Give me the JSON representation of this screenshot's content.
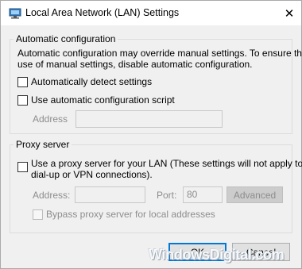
{
  "window": {
    "title": "Local Area Network (LAN) Settings",
    "close_glyph": "✕"
  },
  "automatic_configuration": {
    "legend": "Automatic configuration",
    "description_line1": "Automatic configuration may override manual settings.  To ensure the",
    "description_line2": "use of manual settings, disable automatic configuration.",
    "auto_detect_label": "Automatically detect settings",
    "auto_detect_checked": false,
    "use_script_label": "Use automatic configuration script",
    "use_script_checked": false,
    "address_label": "Address",
    "address_value": ""
  },
  "proxy_server": {
    "legend": "Proxy server",
    "use_proxy_line1": "Use a proxy server for your LAN (These settings will not apply to",
    "use_proxy_line2": "dial-up or VPN connections).",
    "use_proxy_checked": false,
    "address_label": "Address:",
    "address_value": "",
    "port_label": "Port:",
    "port_value": "80",
    "advanced_label": "Advanced",
    "bypass_label": "Bypass proxy server for local addresses",
    "bypass_checked": false
  },
  "buttons": {
    "ok_label": "OK",
    "cancel_label": "Cancel"
  },
  "watermark": "WindowsDigital.com",
  "colors": {
    "accent": "#0078d7",
    "disabled_text": "#8d8d8d"
  }
}
